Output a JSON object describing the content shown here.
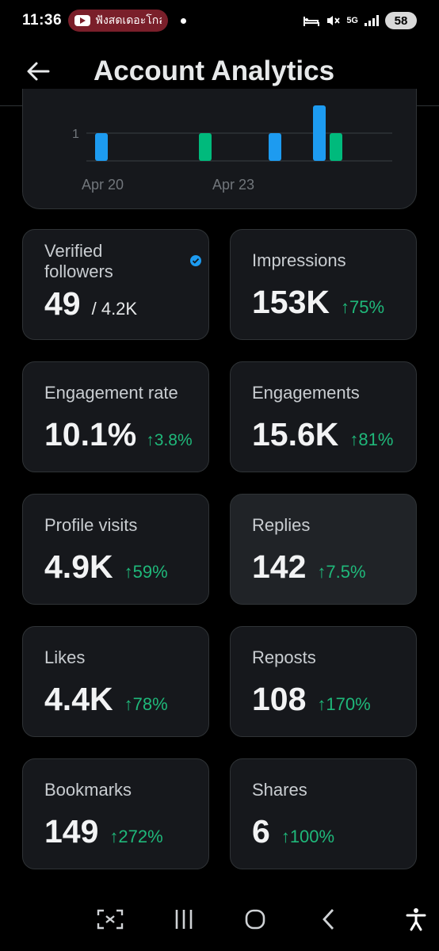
{
  "status": {
    "time": "11:36",
    "notification_text": "ฟังสดเดอะโกล",
    "network_label": "5G",
    "battery": "58"
  },
  "header": {
    "title": "Account Analytics"
  },
  "chart_data": {
    "type": "bar",
    "ytick_label": "1",
    "xtick_labels": [
      "Apr 20",
      "Apr 23"
    ],
    "bars": [
      {
        "series_color": "#1d9bf0",
        "value": 1
      },
      {
        "series_color": "#00ba7c",
        "value": 1
      },
      {
        "series_color": "#1d9bf0",
        "value": 1
      },
      {
        "series_color": "#1d9bf0",
        "value": 2
      },
      {
        "series_color": "#00ba7c",
        "value": 1
      }
    ]
  },
  "metrics": [
    {
      "label": "Verified followers",
      "value": "49",
      "total": "/ 4.2K",
      "icon": "verified-badge-icon"
    },
    {
      "label": "Impressions",
      "value": "153K",
      "change": "↑75%"
    },
    {
      "label": "Engagement rate",
      "value": "10.1%",
      "change": "↑3.8%"
    },
    {
      "label": "Engagements",
      "value": "15.6K",
      "change": "↑81%"
    },
    {
      "label": "Profile visits",
      "value": "4.9K",
      "change": "↑59%"
    },
    {
      "label": "Replies",
      "value": "142",
      "change": "↑7.5%"
    },
    {
      "label": "Likes",
      "value": "4.4K",
      "change": "↑78%"
    },
    {
      "label": "Reposts",
      "value": "108",
      "change": "↑170%"
    },
    {
      "label": "Bookmarks",
      "value": "149",
      "change": "↑272%"
    },
    {
      "label": "Shares",
      "value": "6",
      "change": "↑100%"
    }
  ],
  "colors": {
    "positive": "#1fb87a",
    "accent_blue": "#1d9bf0",
    "accent_green": "#00ba7c"
  }
}
